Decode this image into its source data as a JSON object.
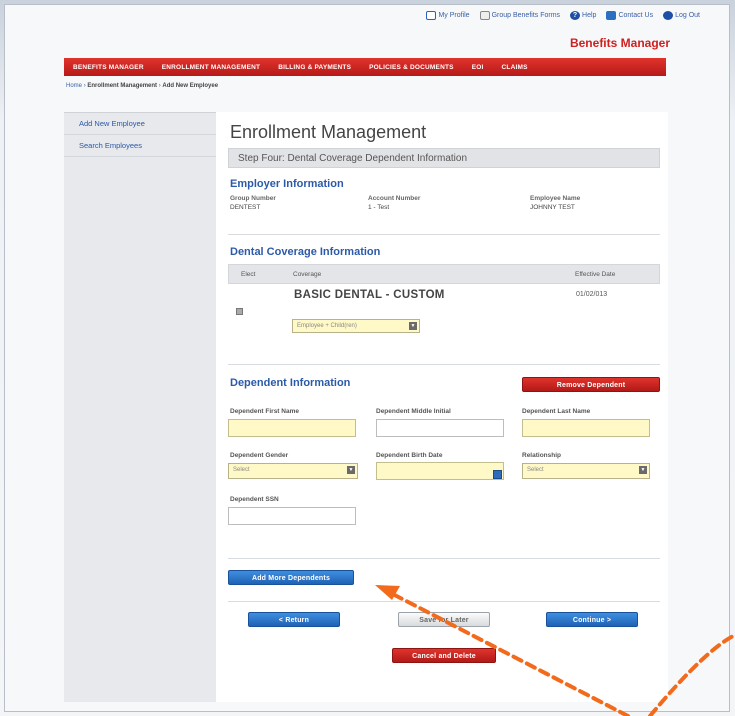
{
  "top_links": [
    {
      "label": "My Profile",
      "icon": "profile-icon"
    },
    {
      "label": "Group Benefits Forms",
      "icon": "forms-icon"
    },
    {
      "label": "Help",
      "icon": "help-icon"
    },
    {
      "label": "Contact Us",
      "icon": "contact-icon"
    },
    {
      "label": "Log Out",
      "icon": "logout-icon"
    }
  ],
  "brand": "Benefits Manager",
  "nav": [
    "BENEFITS MANAGER",
    "ENROLLMENT MANAGEMENT",
    "BILLING & PAYMENTS",
    "POLICIES & DOCUMENTS",
    "EOI",
    "CLAIMS"
  ],
  "breadcrumb": {
    "home": "Home",
    "sep": "›",
    "level1": "Enrollment Management",
    "level2": "Add New Employee"
  },
  "sidebar": [
    "Add New Employee",
    "Search Employees"
  ],
  "page_title": "Enrollment Management",
  "step": "Step Four: Dental Coverage Dependent Information",
  "employer": {
    "section_title": "Employer Information",
    "group_number_label": "Group Number",
    "group_number": "DENTEST",
    "account_number_label": "Account Number",
    "account_number": "1 - Test",
    "employee_name_label": "Employee Name",
    "employee_name": "JOHNNY TEST"
  },
  "coverage": {
    "section_title": "Dental Coverage Information",
    "col_elect": "Elect",
    "col_coverage": "Coverage",
    "col_effective": "Effective Date",
    "plan_name": "BASIC DENTAL - CUSTOM",
    "effective_date": "01/02/013",
    "tier_selected": "Employee + Child(ren)"
  },
  "dependent": {
    "section_title": "Dependent Information",
    "remove_button": "Remove Dependent",
    "first_name_label": "Dependent First Name",
    "middle_initial_label": "Dependent Middle Initial",
    "last_name_label": "Dependent Last Name",
    "gender_label": "Dependent Gender",
    "gender_selected": "Select",
    "birth_date_label": "Dependent Birth Date",
    "relationship_label": "Relationship",
    "relationship_selected": "Select",
    "ssn_label": "Dependent SSN"
  },
  "buttons": {
    "add_more": "Add More Dependents",
    "return": "< Return",
    "save_later": "Save for Later",
    "continue": "Continue >",
    "cancel_delete": "Cancel and Delete"
  },
  "colors": {
    "brand_red": "#d01f1f",
    "link_blue": "#2c5aa8",
    "field_yellow": "#fff9c8",
    "annotation_orange": "#f26a1b"
  }
}
